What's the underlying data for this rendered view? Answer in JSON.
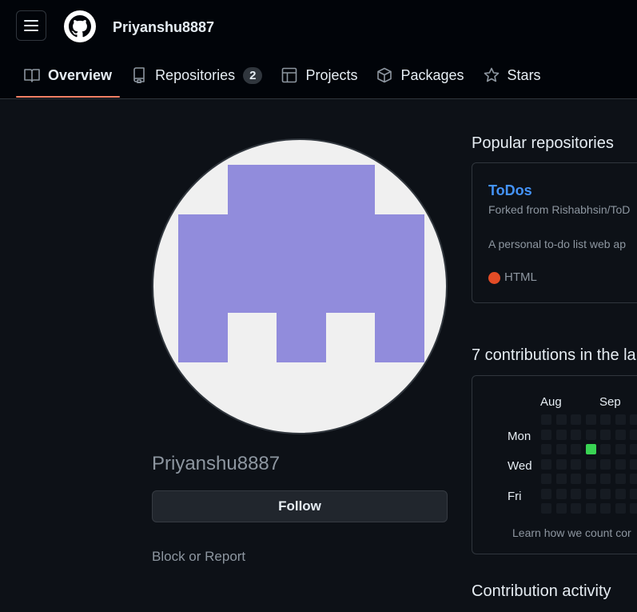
{
  "header": {
    "username": "Priyanshu8887",
    "tabs": [
      {
        "label": "Overview",
        "icon": "book-icon",
        "active": true
      },
      {
        "label": "Repositories",
        "icon": "repo-icon",
        "count": "2"
      },
      {
        "label": "Projects",
        "icon": "table-icon"
      },
      {
        "label": "Packages",
        "icon": "package-icon"
      },
      {
        "label": "Stars",
        "icon": "star-icon"
      }
    ]
  },
  "profile": {
    "name": "Priyanshu8887",
    "follow_label": "Follow",
    "block_label": "Block or Report"
  },
  "popular": {
    "title": "Popular repositories",
    "repo": {
      "name": "ToDos",
      "forked_from": "Forked from Rishabhsin/ToD",
      "description": "A personal to-do list web ap",
      "language": "HTML",
      "language_color": "#e34c26"
    }
  },
  "contributions": {
    "title": "7 contributions in the la",
    "months": [
      "Aug",
      "Sep"
    ],
    "days": [
      "Mon",
      "Wed",
      "Fri"
    ],
    "learn_more": "Learn how we count cor",
    "active_color": "#39d353",
    "empty_color": "#161b22"
  },
  "activity": {
    "title": "Contribution activity"
  },
  "colors": {
    "background": "#0d1117",
    "header_bg": "#010409",
    "accent_underline": "#f78166",
    "link": "#4493f8",
    "avatar_fill": "#918cdc"
  }
}
